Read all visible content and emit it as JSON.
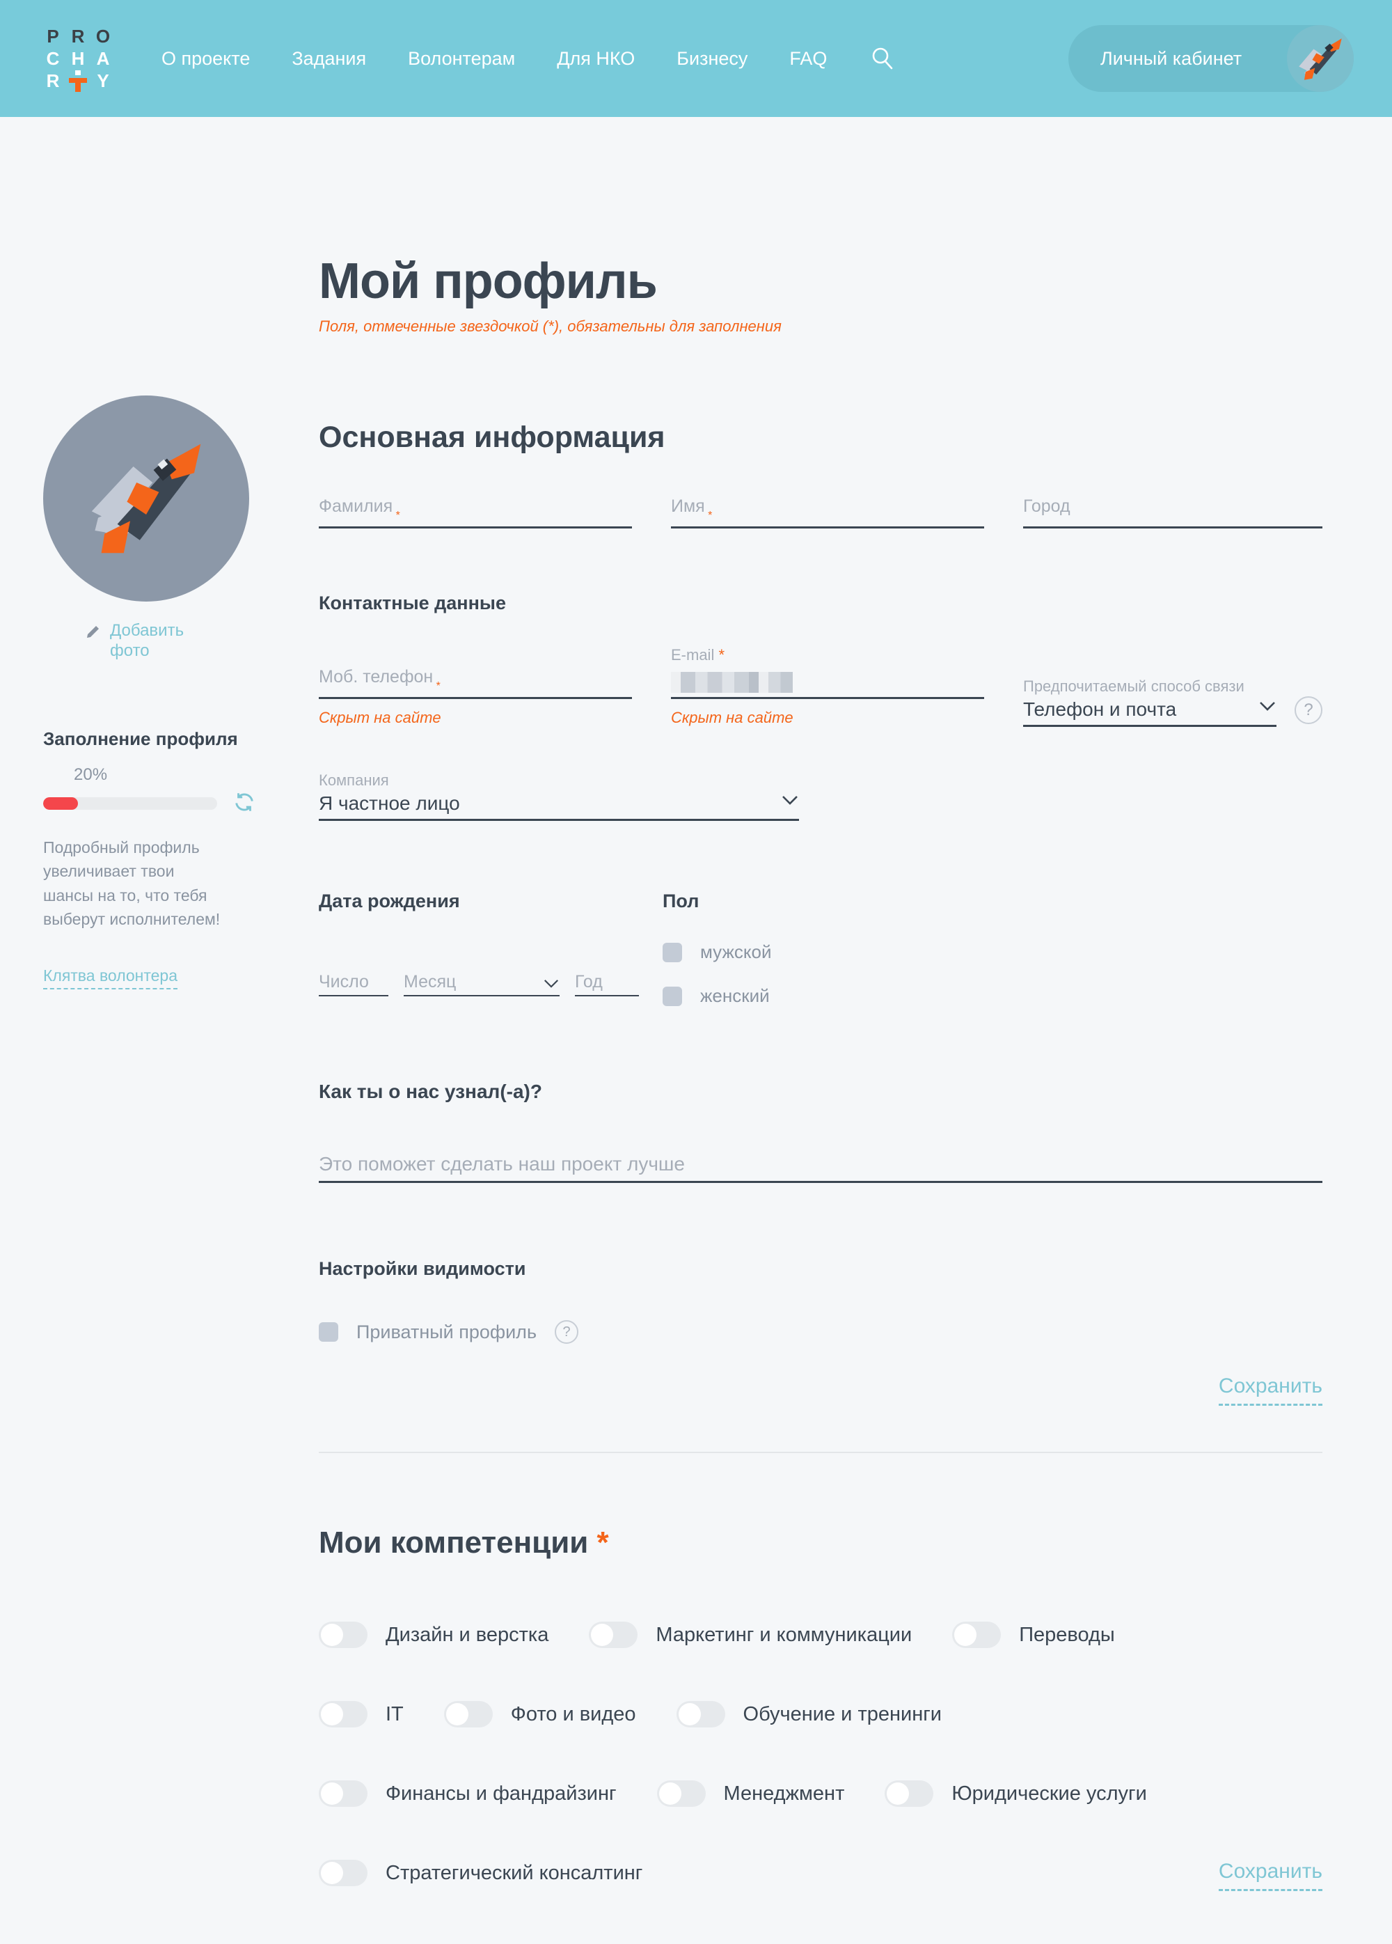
{
  "header": {
    "logo": {
      "line1": "PRO",
      "line2": "CHA",
      "line3_left": "R",
      "line3_right": "Y",
      "mark": "cross-icon"
    },
    "nav": [
      {
        "label": "О проекте"
      },
      {
        "label": "Задания"
      },
      {
        "label": "Волонтерам"
      },
      {
        "label": "Для НКО"
      },
      {
        "label": "Бизнесу"
      },
      {
        "label": "FAQ"
      }
    ],
    "search_icon": "search-icon",
    "account_button": {
      "label": "Личный кабинет",
      "avatar_icon": "superhero-avatar-icon"
    },
    "bg_color": "#78cbda",
    "button_color": "#6dbecd"
  },
  "title": {
    "heading": "Мой профиль",
    "subtitle": "Поля, отмеченные звездочкой (*), обязательны для заполнения",
    "subtitle_color": "#f4651a"
  },
  "sidebar": {
    "avatar_icon": "superhero-avatar-icon",
    "add_photo": {
      "icon": "pencil-icon",
      "label": "Добавить фото"
    },
    "completion": {
      "title": "Заполнение профиля",
      "percent_label": "20%",
      "percent_value": 20,
      "bar_color": "#f4464b",
      "refresh_icon": "refresh-icon",
      "note": "Подробный профиль увеличивает твои шансы на то, что тебя выберут исполнителем!"
    },
    "oath_link": "Клятва волонтера",
    "link_color": "#7fc6d4"
  },
  "main_info": {
    "heading": "Основная информация",
    "fields": [
      {
        "label": "Фамилия",
        "required": true,
        "value": ""
      },
      {
        "label": "Имя",
        "required": true,
        "value": ""
      },
      {
        "label": "Город",
        "required": false,
        "value": ""
      }
    ]
  },
  "contacts": {
    "heading": "Контактные данные",
    "phone": {
      "label": "Моб. телефон",
      "required": true,
      "value": "",
      "hint": "Скрыт на сайте"
    },
    "email": {
      "label": "E-mail",
      "required": true,
      "value": "[redacted]",
      "hint": "Скрыт на сайте"
    },
    "preferred": {
      "label": "Предпочитаемый способ связи",
      "value": "Телефон и почта",
      "chevron_icon": "chevron-down-icon",
      "help_icon": "question-mark-icon"
    }
  },
  "company": {
    "label": "Компания",
    "value": "Я частное лицо",
    "chevron_icon": "chevron-down-icon"
  },
  "birth": {
    "heading": "Дата рождения",
    "day_placeholder": "Число",
    "month_placeholder": "Месяц",
    "year_placeholder": "Год",
    "chevron_icon": "chevron-down-icon"
  },
  "gender": {
    "heading": "Пол",
    "options": [
      {
        "label": "мужской",
        "checked": false
      },
      {
        "label": "женский",
        "checked": false
      }
    ]
  },
  "how_heard": {
    "heading": "Как ты о нас узнал(-а)?",
    "placeholder": "Это поможет сделать наш проект лучше",
    "value": ""
  },
  "visibility": {
    "heading": "Настройки видимости",
    "private_profile": {
      "label": "Приватный профиль",
      "checked": false,
      "help_icon": "question-mark-icon"
    },
    "save_label": "Сохранить"
  },
  "competencies": {
    "heading": "Мои компетенции",
    "required": true,
    "save_label": "Сохранить",
    "rows": [
      [
        {
          "label": "Дизайн и верстка",
          "on": false
        },
        {
          "label": "Маркетинг и коммуникации",
          "on": false
        },
        {
          "label": "Переводы",
          "on": false
        }
      ],
      [
        {
          "label": "IT",
          "on": false
        },
        {
          "label": "Фото и видео",
          "on": false
        },
        {
          "label": "Обучение и тренинги",
          "on": false
        }
      ],
      [
        {
          "label": "Финансы и фандрайзинг",
          "on": false
        },
        {
          "label": "Менеджмент",
          "on": false
        },
        {
          "label": "Юридические услуги",
          "on": false
        }
      ],
      [
        {
          "label": "Стратегический консалтинг",
          "on": false
        }
      ]
    ]
  }
}
